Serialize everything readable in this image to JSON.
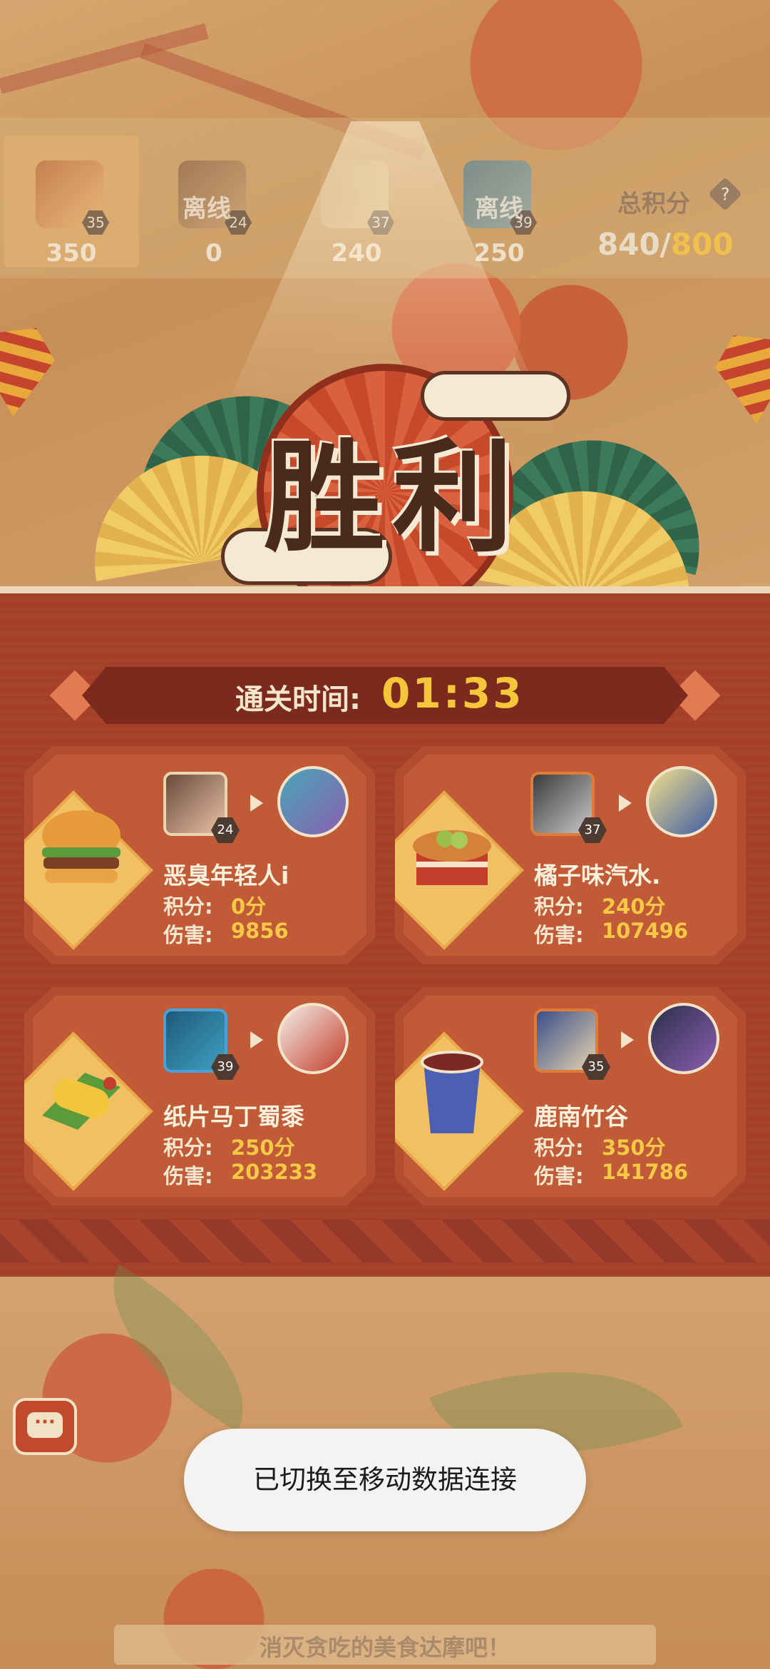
{
  "scoreboard": {
    "players": [
      {
        "points": "350",
        "level": "35",
        "status": ""
      },
      {
        "points": "0",
        "level": "24",
        "status": "离线"
      },
      {
        "points": "240",
        "level": "37",
        "status": ""
      },
      {
        "points": "250",
        "level": "39",
        "status": "离线"
      }
    ],
    "total_label": "总积分",
    "help_icon": "?",
    "total_current": "840",
    "total_separator": "/",
    "total_goal": "800"
  },
  "banner": {
    "title": "胜利"
  },
  "clear_time": {
    "label": "通关时间:",
    "value": "01:33"
  },
  "results": [
    {
      "name": "恶臭年轻人i",
      "food_icon": "burger-icon",
      "level": "24",
      "score_label": "积分:",
      "score": "0分",
      "damage_label": "伤害:",
      "damage": "9856"
    },
    {
      "name": "橘子味汽水.",
      "food_icon": "bread-basket-icon",
      "level": "37",
      "score_label": "积分:",
      "score": "240分",
      "damage_label": "伤害:",
      "damage": "107496"
    },
    {
      "name": "纸片马丁蜀黍",
      "food_icon": "corn-icon",
      "level": "39",
      "score_label": "积分:",
      "score": "250分",
      "damage_label": "伤害:",
      "damage": "203233"
    },
    {
      "name": "鹿南竹谷",
      "food_icon": "drink-cup-icon",
      "level": "35",
      "score_label": "积分:",
      "score": "350分",
      "damage_label": "伤害:",
      "damage": "141786"
    }
  ],
  "chat": {
    "icon": "chat-bubble-icon",
    "glyph": "···"
  },
  "toast": {
    "text": "已切换至移动数据连接"
  },
  "footer": {
    "text": "消灭贪吃的美食达摩吧！"
  },
  "colors": {
    "accent_gold": "#f6c845",
    "panel_red": "#a8432b",
    "cream": "#f3e4c9"
  }
}
